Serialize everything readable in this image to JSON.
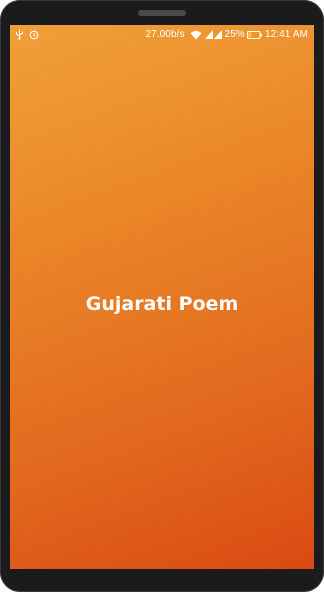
{
  "status_bar": {
    "net_speed": "27.00b/s",
    "battery_percent": "25%",
    "time": "12:41 AM",
    "icons": [
      "usb-icon",
      "alarm-icon",
      "wifi-icon",
      "signal-icon",
      "signal-icon",
      "battery-icon"
    ],
    "battery_level_fraction": 0.25,
    "battery_fill_color": "#f2d23c"
  },
  "splash": {
    "title": "Gujarati Poem",
    "gradient_colors": [
      "#f0a038",
      "#ea8628",
      "#e2691e",
      "#d94a12"
    ]
  },
  "device_frame_color": "#1b1b1d"
}
